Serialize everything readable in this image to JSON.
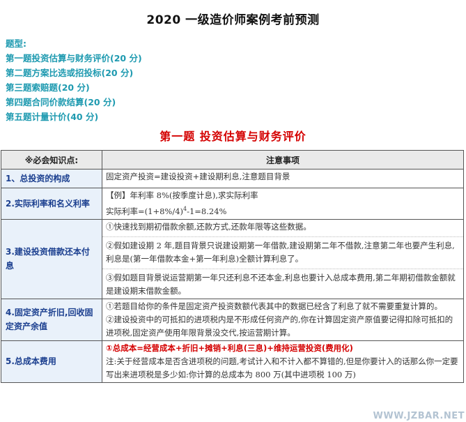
{
  "page": {
    "title": "2020 一级造价师案例考前预测",
    "types_label": "题型:",
    "types": [
      "第一题投资估算与财务评价(20 分)",
      "第二题方案比选或招投标(20 分)",
      "第三题索赔题(20 分)",
      "第四题合同价款结算(20 分)",
      "第五题计量计价(40 分)"
    ],
    "section_title": "第一题   投资估算与财务评价"
  },
  "table": {
    "headers": [
      "※必会知识点:",
      "注意事项"
    ],
    "rows": [
      {
        "key": "1、总投资的构成",
        "lines": [
          "固定资产投资=建设投资+建设期利息,注意题目背景"
        ]
      },
      {
        "key": "2.实际利率和名义利率",
        "lines": [
          "【例】年利率 8%(按季度计息),求实际利率"
        ],
        "formula_prefix": "实际利率=(1+8%/4)",
        "formula_exp": "4",
        "formula_suffix": "-1=8.24%"
      },
      {
        "key": "3.建设投资借款还本付息",
        "paras": [
          "①快速找到期初借款余额,还款方式,还款年限等这些数据。",
          "②假如建设期 2 年,题目背景只说建设期第一年借款,建设期第二年不借款,注意第二年也要产生利息,利息是(第一年借款本金+第一年利息)全额计算利息了。",
          "③假如题目背景说运营期第一年只还利息不还本金,利息也要计入总成本费用,第二年期初借款金额就是建设期末借款金额。"
        ]
      },
      {
        "key": "4.固定资产折旧,回收固定资产余值",
        "paras": [
          "①若题目给你的条件是固定资产投资数额代表其中的数据已经含了利息了就不需要重复计算的。",
          "②建设投资中的可抵扣的进项税内是不形成任何资产的,你在计算固定资产原值要记得扣除可抵扣的进项税,固定资产使用年限背景没交代,按运营期计算。"
        ]
      },
      {
        "key": "5.总成本费用",
        "red": "①总成本=经营成本+折旧+摊销+利息(三息)+维持运营投资(费用化)",
        "note": "注:关于经营成本是否含进项税的问题,考试计入和不计入都不算错的,但是你要计入的话那么你一定要写出来进项税是多少如:你计算的总成本为 800 万(其中进项税 100 万)"
      }
    ]
  },
  "watermark": "WWW.JZBAR.NET"
}
